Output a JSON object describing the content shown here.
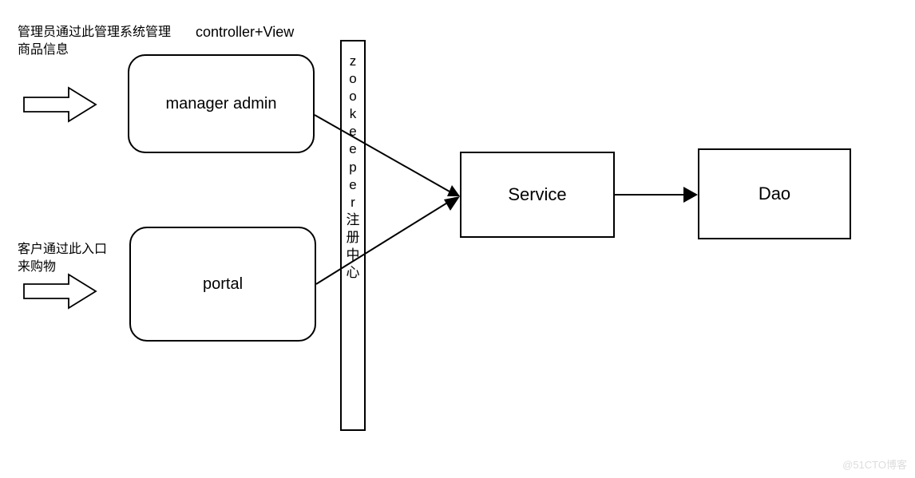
{
  "annotations": {
    "admin_desc_line1": "管理员通过此管理系统管理",
    "admin_desc_line2": "商品信息",
    "portal_desc_line1": "客户通过此入口",
    "portal_desc_line2": "来购物"
  },
  "labels": {
    "header": "controller+View",
    "manager_admin": "manager admin",
    "portal": "portal",
    "zookeeper": "zookeeper 注册中心",
    "service": "Service",
    "dao": "Dao"
  },
  "watermark": "@51CTO博客"
}
